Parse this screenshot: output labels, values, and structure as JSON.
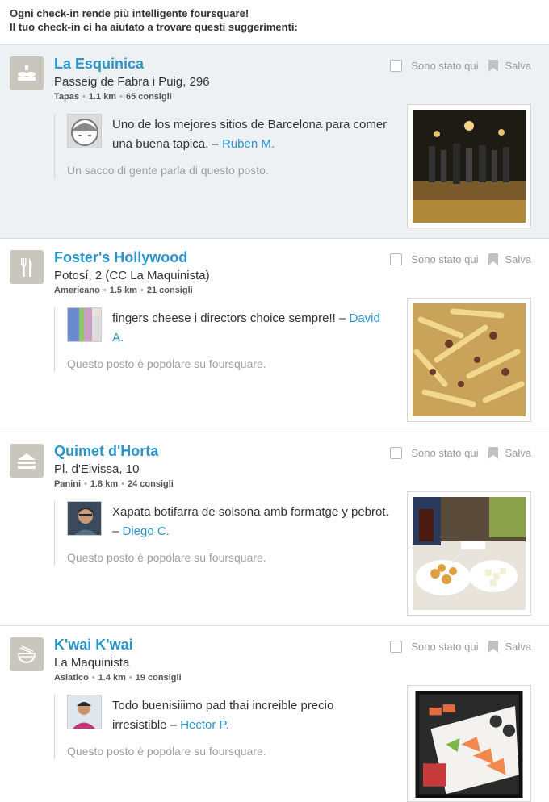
{
  "header": {
    "line1": "Ogni check-in rende più intelligente foursquare!",
    "line2": "Il tuo check-in ci ha aiutato a trovare questi suggerimenti:"
  },
  "actions": {
    "been_here": "Sono stato qui",
    "save": "Salva"
  },
  "venues": [
    {
      "name": "La Esquinica",
      "address": "Passeig de Fabra i Puig, 296",
      "category": "Tapas",
      "distance": "1.1 km",
      "tips": "65 consigli",
      "tip_text": "Uno de los mejores sitios de Barcelona para comer una buena tapica. –",
      "tip_author": "Ruben M.",
      "note": "Un sacco di gente parla di questo posto.",
      "icon": "tapas-icon"
    },
    {
      "name": "Foster's Hollywood",
      "address": "Potosí, 2 (CC La Maquinista)",
      "category": "Americano",
      "distance": "1.5 km",
      "tips": "21 consigli",
      "tip_text": "fingers cheese i directors choice sempre!! –",
      "tip_author": "David A.",
      "note": "Questo posto è popolare su foursquare.",
      "icon": "fork-knife-icon"
    },
    {
      "name": "Quimet d'Horta",
      "address": "Pl. d'Eivissa, 10",
      "category": "Panini",
      "distance": "1.8 km",
      "tips": "24 consigli",
      "tip_text": "Xapata botifarra de solsona amb formatge y pebrot. –",
      "tip_author": "Diego C.",
      "note": "Questo posto è popolare su foursquare.",
      "icon": "sandwich-icon"
    },
    {
      "name": "K'wai K'wai",
      "address": "La Maquinista",
      "category": "Asiatico",
      "distance": "1.4 km",
      "tips": "19 consigli",
      "tip_text": "Todo buenisiiimo pad thai increible precio irresistible –",
      "tip_author": "Hector P.",
      "note": "Questo posto è popolare su foursquare.",
      "icon": "noodle-bowl-icon"
    }
  ]
}
